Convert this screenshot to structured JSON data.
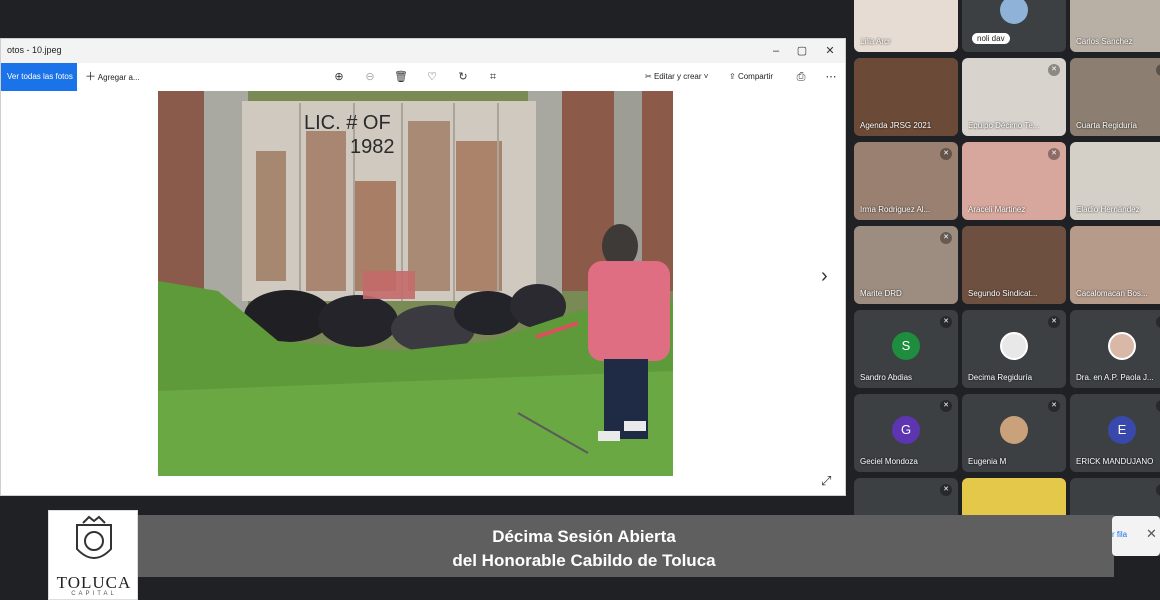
{
  "viewer": {
    "title": "otos - 10.jpeg",
    "toolbar": {
      "see_all": "Ver todas las fotos",
      "add_to": "Agregar a...",
      "edit": "Editar y crear",
      "share": "Compartir"
    },
    "photo_text": {
      "line1": "LIC. # OF",
      "line2": "1982"
    }
  },
  "participants": [
    {
      "name": "Lilia Arcr"
    },
    {
      "name": "noli dav"
    },
    {
      "name": "Carlos Sanchez"
    },
    {
      "name": "Agenda JRSG 2021"
    },
    {
      "name": "Equipo Décimo Te..."
    },
    {
      "name": "Cuarta Regiduría"
    },
    {
      "name": "Irma Rodriguez Al..."
    },
    {
      "name": "Araceli Martinez"
    },
    {
      "name": "Eladio Hernández"
    },
    {
      "name": "Marite DRD"
    },
    {
      "name": "Segundo Sindicat..."
    },
    {
      "name": "Cacalomacan Bos..."
    },
    {
      "name": "Sandro Abdias",
      "initial": "S",
      "color": "#1e8e3e"
    },
    {
      "name": "Decima Regiduría"
    },
    {
      "name": "Dra. en A.P. Paola J..."
    },
    {
      "name": "Geciel Mondoza",
      "initial": "G",
      "color": "#5e35b1"
    },
    {
      "name": "Eugenia M"
    },
    {
      "name": "ERICK MANDUJANO",
      "initial": "E",
      "color": "#3949ab"
    }
  ],
  "lower_third": {
    "line1": "Décima Sesión Abierta",
    "line2": "del Honorable Cabildo de Toluca"
  },
  "logo": {
    "brand": "TOLUCA",
    "sub": "CAPITAL"
  },
  "chip": {
    "text": "r fila",
    "close": "✕"
  }
}
